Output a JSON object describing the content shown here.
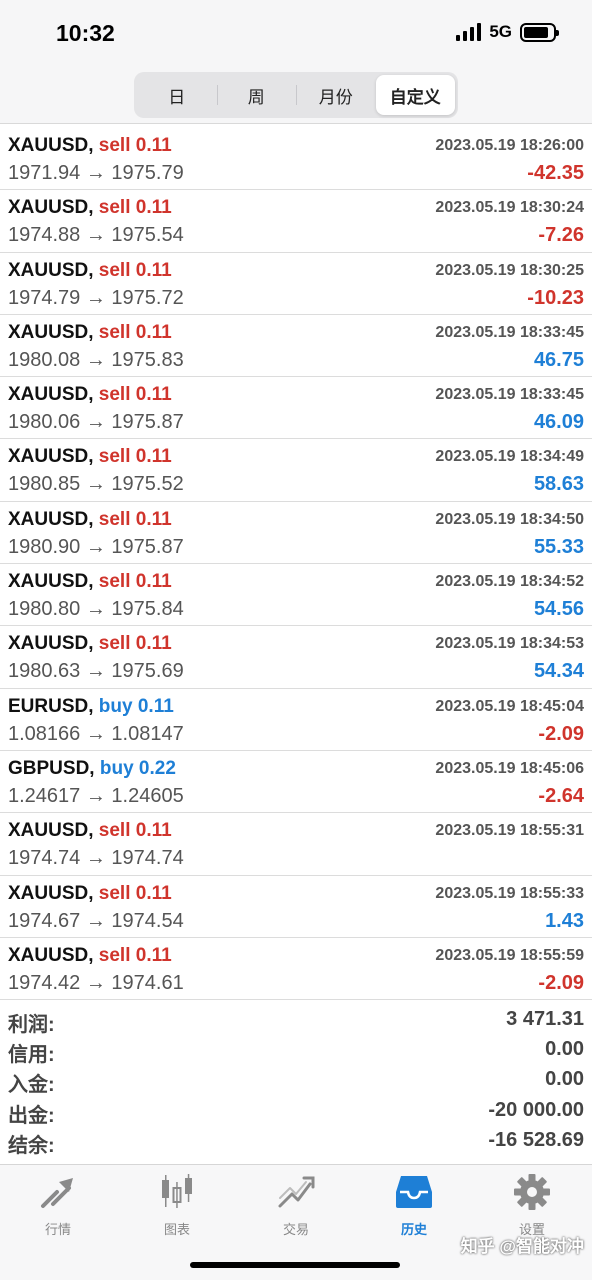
{
  "status_bar": {
    "time": "10:32",
    "network": "5G"
  },
  "segments": [
    "日",
    "周",
    "月份",
    "自定义"
  ],
  "trades": [
    {
      "symbol": "XAUUSD,",
      "side": "sell",
      "side_label": "sell 0.11",
      "timestamp": "2023.05.19 18:26:00",
      "prices": "1971.94 → 1975.79",
      "profit": "-42.35"
    },
    {
      "symbol": "XAUUSD,",
      "side": "sell",
      "side_label": "sell 0.11",
      "timestamp": "2023.05.19 18:30:24",
      "prices": "1974.88 → 1975.54",
      "profit": "-7.26"
    },
    {
      "symbol": "XAUUSD,",
      "side": "sell",
      "side_label": "sell 0.11",
      "timestamp": "2023.05.19 18:30:25",
      "prices": "1974.79 → 1975.72",
      "profit": "-10.23"
    },
    {
      "symbol": "XAUUSD,",
      "side": "sell",
      "side_label": "sell 0.11",
      "timestamp": "2023.05.19 18:33:45",
      "prices": "1980.08 → 1975.83",
      "profit": "46.75"
    },
    {
      "symbol": "XAUUSD,",
      "side": "sell",
      "side_label": "sell 0.11",
      "timestamp": "2023.05.19 18:33:45",
      "prices": "1980.06 → 1975.87",
      "profit": "46.09"
    },
    {
      "symbol": "XAUUSD,",
      "side": "sell",
      "side_label": "sell 0.11",
      "timestamp": "2023.05.19 18:34:49",
      "prices": "1980.85 → 1975.52",
      "profit": "58.63"
    },
    {
      "symbol": "XAUUSD,",
      "side": "sell",
      "side_label": "sell 0.11",
      "timestamp": "2023.05.19 18:34:50",
      "prices": "1980.90 → 1975.87",
      "profit": "55.33"
    },
    {
      "symbol": "XAUUSD,",
      "side": "sell",
      "side_label": "sell 0.11",
      "timestamp": "2023.05.19 18:34:52",
      "prices": "1980.80 → 1975.84",
      "profit": "54.56"
    },
    {
      "symbol": "XAUUSD,",
      "side": "sell",
      "side_label": "sell 0.11",
      "timestamp": "2023.05.19 18:34:53",
      "prices": "1980.63 → 1975.69",
      "profit": "54.34"
    },
    {
      "symbol": "EURUSD,",
      "side": "buy",
      "side_label": "buy 0.11",
      "timestamp": "2023.05.19 18:45:04",
      "prices": "1.08166 → 1.08147",
      "profit": "-2.09"
    },
    {
      "symbol": "GBPUSD,",
      "side": "buy",
      "side_label": "buy 0.22",
      "timestamp": "2023.05.19 18:45:06",
      "prices": "1.24617 → 1.24605",
      "profit": "-2.64"
    },
    {
      "symbol": "XAUUSD,",
      "side": "sell",
      "side_label": "sell 0.11",
      "timestamp": "2023.05.19 18:55:31",
      "prices": "1974.74 → 1974.74",
      "profit": ""
    },
    {
      "symbol": "XAUUSD,",
      "side": "sell",
      "side_label": "sell 0.11",
      "timestamp": "2023.05.19 18:55:33",
      "prices": "1974.67 → 1974.54",
      "profit": "1.43"
    },
    {
      "symbol": "XAUUSD,",
      "side": "sell",
      "side_label": "sell 0.11",
      "timestamp": "2023.05.19 18:55:59",
      "prices": "1974.42 → 1974.61",
      "profit": "-2.09"
    }
  ],
  "summary": [
    {
      "label": "利润:",
      "value": "3 471.31"
    },
    {
      "label": "信用:",
      "value": "0.00"
    },
    {
      "label": "入金:",
      "value": "0.00"
    },
    {
      "label": "出金:",
      "value": "-20 000.00"
    },
    {
      "label": "结余:",
      "value": "-16 528.69"
    }
  ],
  "tabs": [
    {
      "label": "行情",
      "icon": "quotes-arrow-icon"
    },
    {
      "label": "图表",
      "icon": "candlestick-chart-icon"
    },
    {
      "label": "交易",
      "icon": "trade-trend-icon"
    },
    {
      "label": "历史",
      "icon": "history-inbox-icon"
    },
    {
      "label": "设置",
      "icon": "gear-icon"
    }
  ],
  "watermark": "知乎 @智能对冲",
  "colors": {
    "sell": "#d0342c",
    "buy": "#1e7fd6",
    "loss": "#d0342c",
    "profit": "#1e7fd6",
    "active_tab": "#1e7fd6"
  }
}
